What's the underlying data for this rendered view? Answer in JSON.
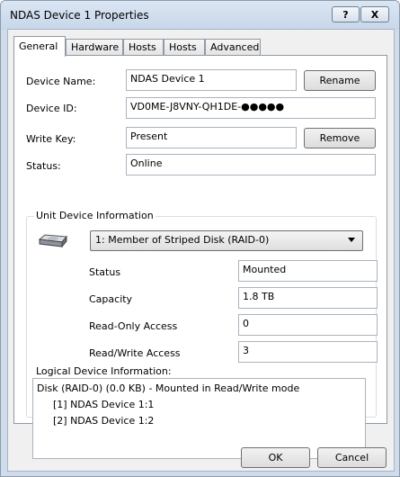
{
  "window": {
    "title": "NDAS Device 1 Properties",
    "help_label": "?",
    "close_label": "X"
  },
  "tabs": [
    {
      "label": "General",
      "active": true
    },
    {
      "label": "Hardware",
      "active": false
    },
    {
      "label": "Hosts",
      "active": false
    },
    {
      "label": "Hosts",
      "active": false
    },
    {
      "label": "Advanced",
      "active": false
    }
  ],
  "general": {
    "device_name_label": "Device Name:",
    "device_name_value": "NDAS Device 1",
    "rename_label": "Rename",
    "device_id_label": "Device ID:",
    "device_id_value": "VD0ME-J8VNY-QH1DE-●●●●●",
    "write_key_label": "Write Key:",
    "write_key_value": "Present",
    "remove_label": "Remove",
    "status_label": "Status:",
    "status_value": "Online"
  },
  "unit": {
    "group_title": "Unit Device Information",
    "selected_unit": "1: Member of Striped Disk (RAID-0)",
    "status_label": "Status",
    "status_value": "Mounted",
    "capacity_label": "Capacity",
    "capacity_value": "1.8 TB",
    "ro_label": "Read-Only Access",
    "ro_value": "0",
    "rw_label": "Read/Write Access",
    "rw_value": "3",
    "logical_label": "Logical Device Information:",
    "logical_lines": [
      "Disk (RAID-0) (0.0 KB) - Mounted in Read/Write mode",
      "[1] NDAS Device 1:1",
      "[2] NDAS Device 1:2"
    ]
  },
  "footer": {
    "ok_label": "OK",
    "cancel_label": "Cancel"
  }
}
